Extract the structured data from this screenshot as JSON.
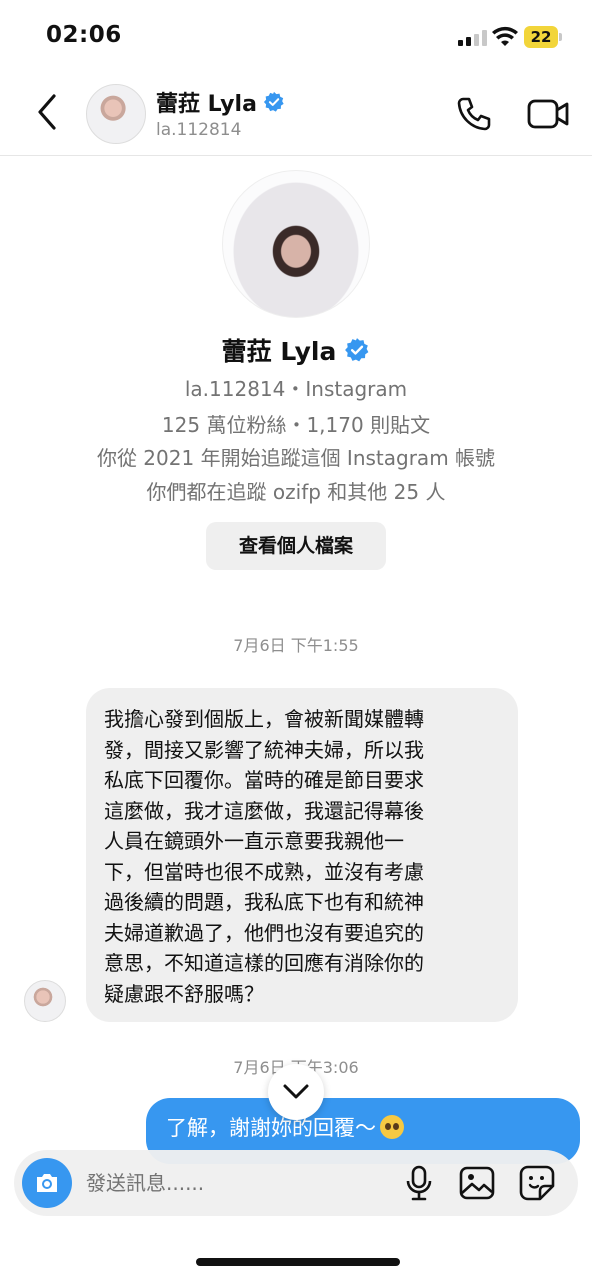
{
  "status_bar": {
    "time": "02:06",
    "battery": "22",
    "icons": [
      "signal-icon",
      "wifi-icon",
      "battery-icon"
    ]
  },
  "header": {
    "name": "蕾菈 Lyla",
    "username": "la.112814",
    "icons": [
      "back-chevron-icon",
      "verified-badge-icon",
      "phone-call-icon",
      "video-call-icon"
    ]
  },
  "profile": {
    "name": "蕾菈 Lyla",
    "handle_line": "la.112814・Instagram",
    "stats_line": "125 萬位粉絲・1,170 則貼文",
    "follow_since": "你從 2021 年開始追蹤這個 Instagram 帳號",
    "mutual": "你們都在追蹤 ozifp 和其他 25 人",
    "view_profile_button": "查看個人檔案"
  },
  "conversation": {
    "timestamp_1": "7月6日 下午1:55",
    "incoming_message_lines": [
      "我擔心發到個版上，會被新聞媒體轉",
      "發，間接又影響了統神夫婦，所以我",
      "私底下回覆你。當時的確是節目要求",
      "這麼做，我才這麼做，我還記得幕後",
      "人員在鏡頭外一直示意要我親他一",
      "下，但當時也很不成熟，並沒有考慮",
      "過後續的問題，我私底下也有和統神",
      "夫婦道歉過了，他們也沒有要追究的",
      "意思，不知道這樣的回應有消除你的",
      "疑慮跟不舒服嗎？"
    ],
    "timestamp_2": "7月6日 下午3:06",
    "outgoing_message": "了解，謝謝妳的回覆～",
    "outgoing_emoji": "pleading-face-emoji"
  },
  "composer": {
    "placeholder": "發送訊息......",
    "icons": [
      "camera-icon",
      "microphone-icon",
      "gallery-icon",
      "sticker-icon"
    ]
  },
  "colors": {
    "accent": "#3797f0",
    "bubble_in": "#efefef",
    "verified": "#3797f0"
  }
}
